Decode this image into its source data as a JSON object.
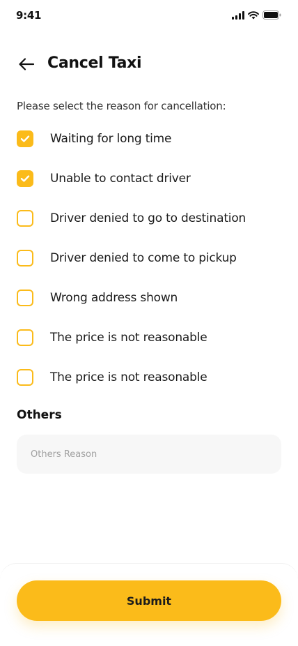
{
  "status_bar": {
    "time": "9:41"
  },
  "header": {
    "title": "Cancel Taxi"
  },
  "prompt": "Please select the reason for cancellation:",
  "reasons": [
    {
      "label": "Waiting for long time",
      "checked": true
    },
    {
      "label": "Unable to contact driver",
      "checked": true
    },
    {
      "label": "Driver denied to go to destination",
      "checked": false
    },
    {
      "label": "Driver denied to come to pickup",
      "checked": false
    },
    {
      "label": "Wrong address shown",
      "checked": false
    },
    {
      "label": "The price is not reasonable",
      "checked": false
    },
    {
      "label": "The price is not reasonable",
      "checked": false
    }
  ],
  "others": {
    "title": "Others",
    "placeholder": "Others Reason",
    "value": ""
  },
  "submit_label": "Submit",
  "colors": {
    "accent": "#fbbb1a",
    "input_bg": "#f7f7f7"
  }
}
